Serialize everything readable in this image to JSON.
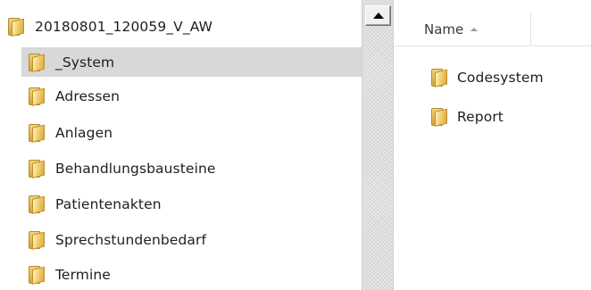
{
  "tree": {
    "root": {
      "label": "20180801_120059_V_AW",
      "icon": "folder-icon"
    },
    "children": [
      {
        "label": "_System",
        "selected": true
      },
      {
        "label": "Adressen",
        "selected": false
      },
      {
        "label": "Anlagen",
        "selected": false
      },
      {
        "label": "Behandlungsbausteine",
        "selected": false
      },
      {
        "label": "Patientenakten",
        "selected": false
      },
      {
        "label": "Sprechstundenbedarf",
        "selected": false
      },
      {
        "label": "Termine",
        "selected": false
      }
    ]
  },
  "scrollbar": {
    "up_icon": "triangle-up-icon"
  },
  "file_list": {
    "column_name": "Name",
    "sort_icon": "sort-ascending-icon",
    "items": [
      {
        "label": "Codesystem",
        "icon": "folder-icon"
      },
      {
        "label": "Report",
        "icon": "folder-icon"
      }
    ]
  },
  "colors": {
    "selected_row": "#d8d8d8",
    "folder": "#f2d274"
  }
}
